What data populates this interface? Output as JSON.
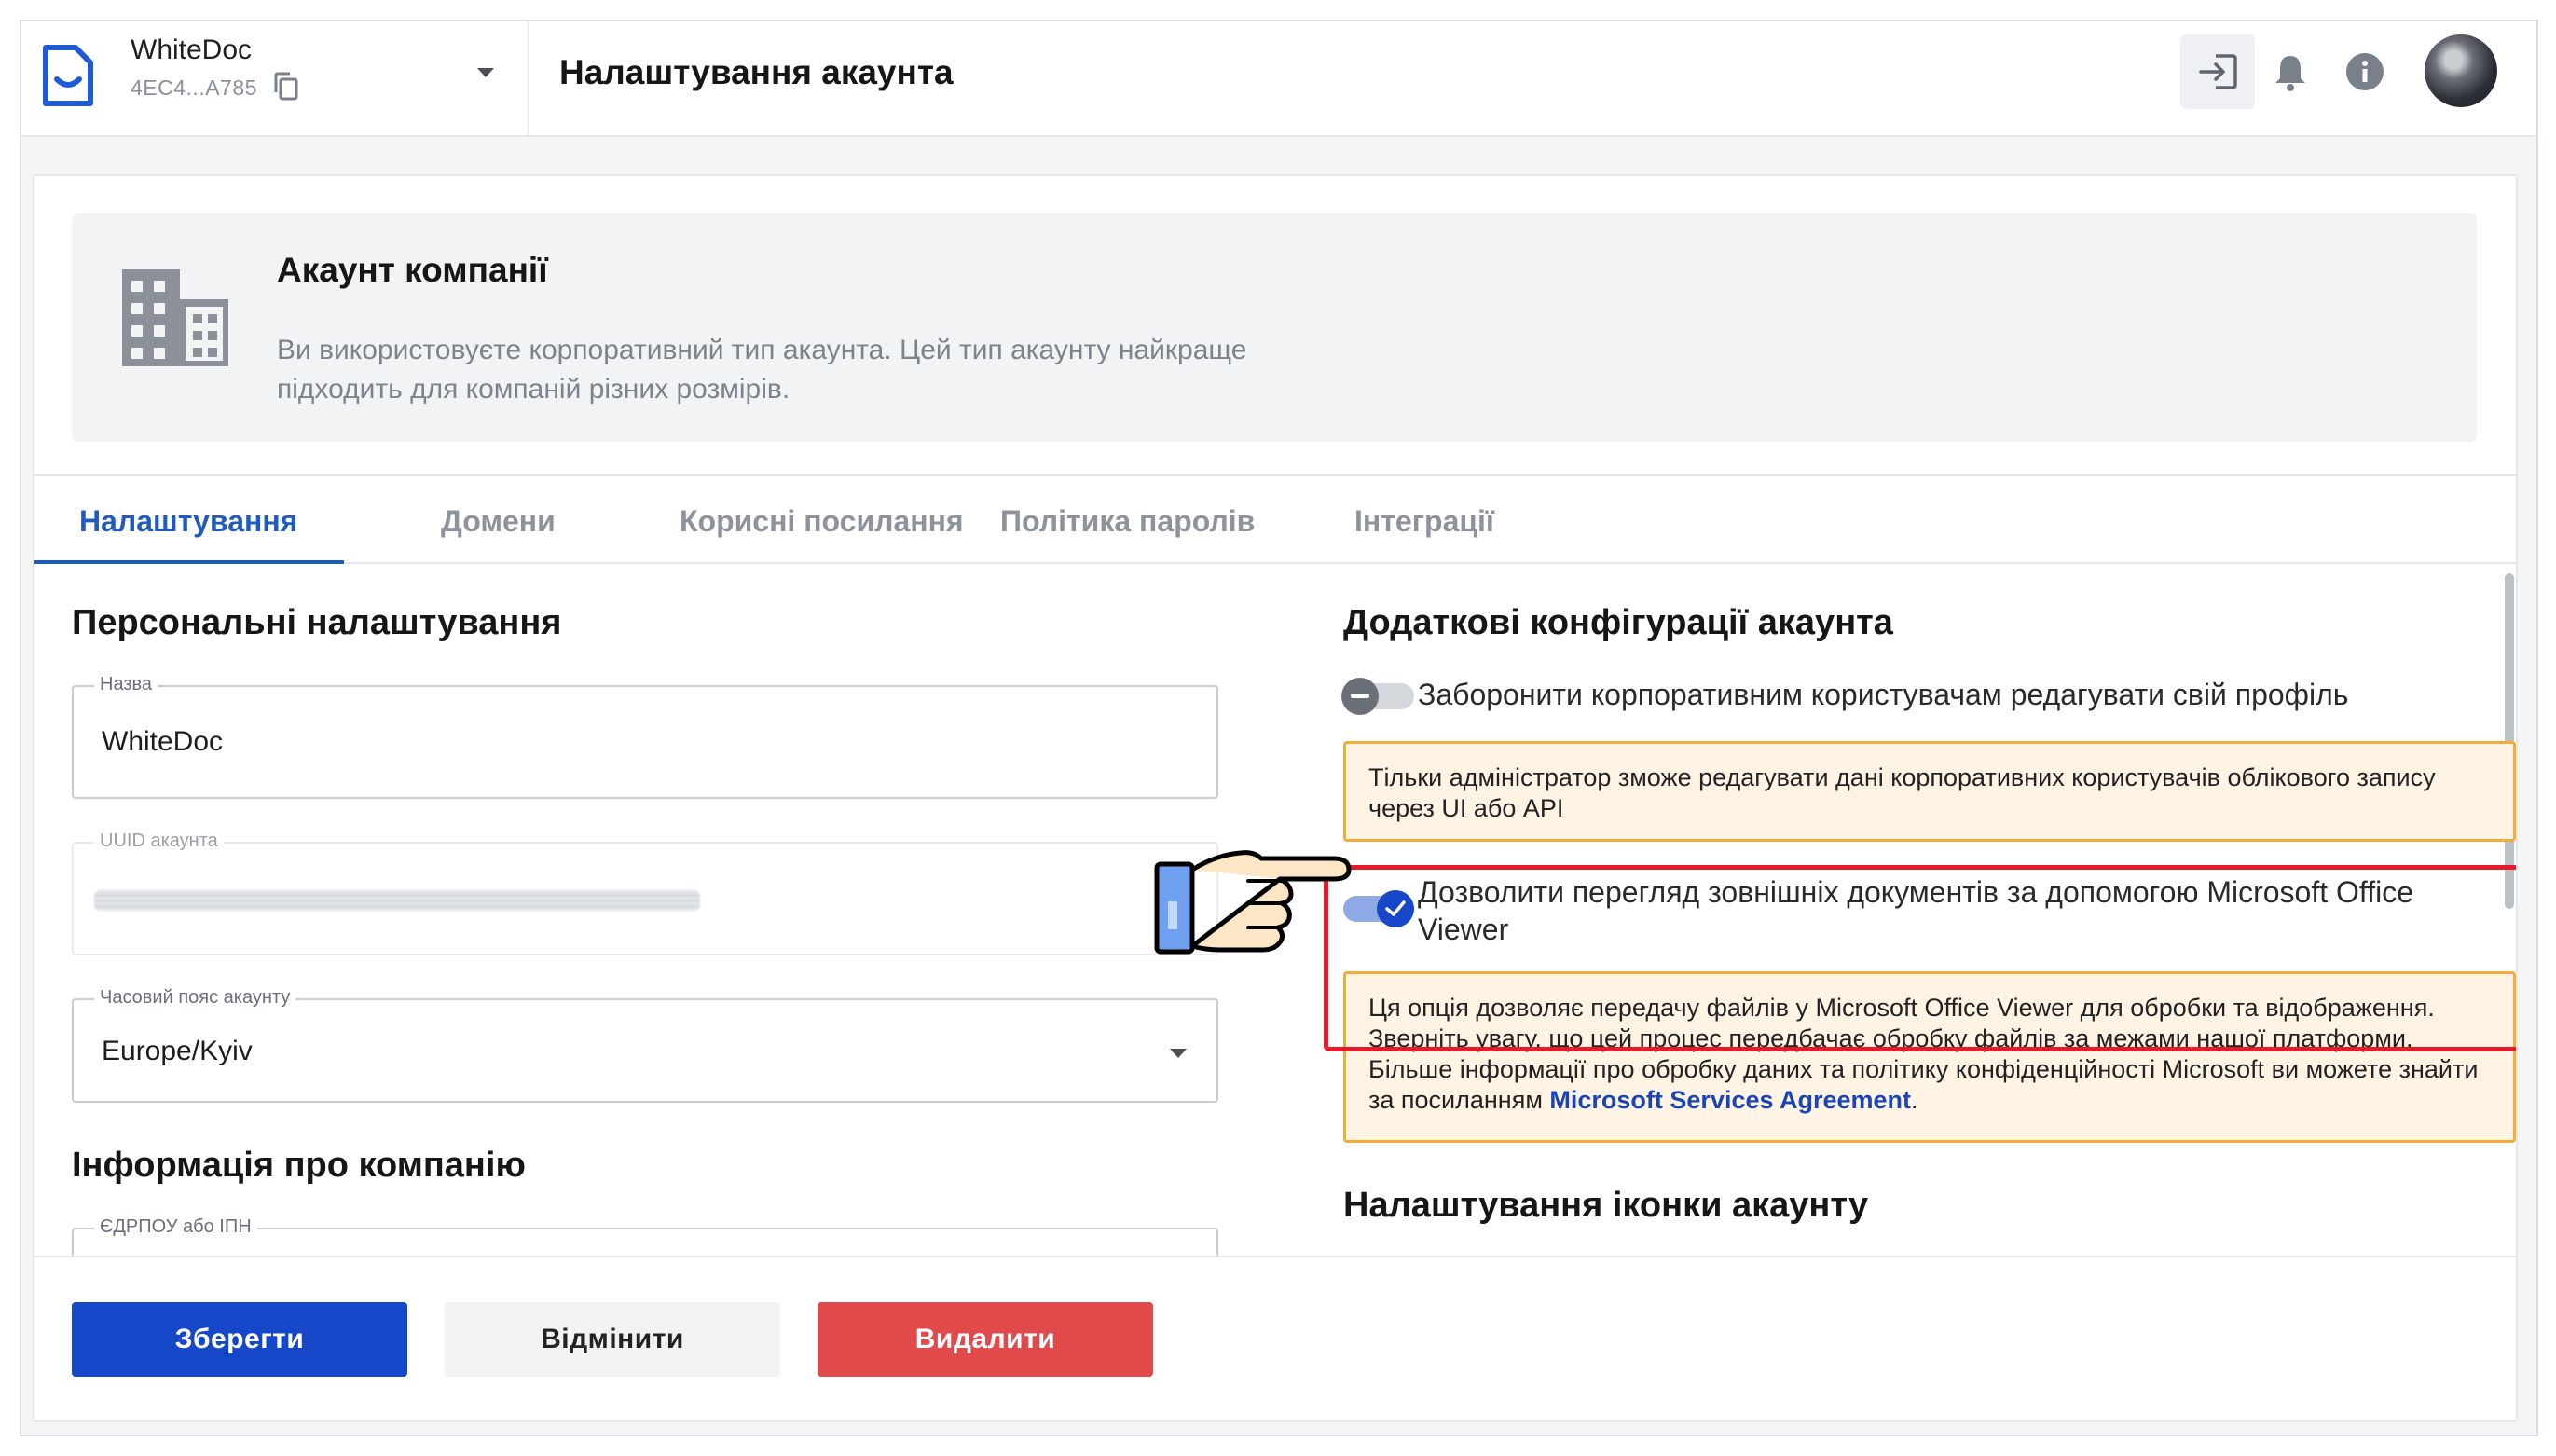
{
  "header": {
    "org_name": "WhiteDoc",
    "org_id": "4EC4...A785",
    "page_title": "Налаштування акаунта"
  },
  "banner": {
    "title": "Акаунт компанії",
    "description": "Ви використовуєте корпоративний тип акаунта. Цей тип акаунту найкраще підходить для компаній різних розмірів."
  },
  "tabs": [
    {
      "label": "Налаштування",
      "active": true
    },
    {
      "label": "Домени",
      "active": false
    },
    {
      "label": "Корисні посилання",
      "active": false
    },
    {
      "label": "Політика паролів",
      "active": false
    },
    {
      "label": "Інтеграції",
      "active": false
    }
  ],
  "personal": {
    "heading": "Персональні налаштування",
    "name_label": "Назва",
    "name_value": "WhiteDoc",
    "uuid_label": "UUID акаунта",
    "timezone_label": "Часовий пояс акаунту",
    "timezone_value": "Europe/Kyiv"
  },
  "company": {
    "heading": "Інформація про компанію",
    "edrpou_label": "ЄДРПОУ або ІПН"
  },
  "extra": {
    "heading": "Додаткові конфігурації акаунта",
    "toggle1_label": "Заборонити корпоративним користувачам редагувати свій профіль",
    "toggle1_on": false,
    "warn1": "Тільки адміністратор зможе редагувати дані корпоративних користувачів облікового запису через UI або API",
    "toggle2_label": "Дозволити перегляд зовнішніх документів за допомогою Microsoft Office Viewer",
    "toggle2_on": true,
    "warn2_text": "Ця опція дозволяє передачу файлів у Microsoft Office Viewer для обробки та відображення. Зверніть увагу, що цей процес передбачає обробку файлів за межами нашої платформи. Більше інформації про обробку даних та політику конфіденційності Microsoft ви можете знайти за посиланням ",
    "warn2_link": "Microsoft Services Agreement",
    "warn2_end": ".",
    "icon_heading": "Налаштування іконки акаунту"
  },
  "actions": {
    "save": "Зберегти",
    "cancel": "Відмінити",
    "delete": "Видалити"
  },
  "colors": {
    "primary": "#1547c8",
    "danger": "#e04a4a",
    "warning_border": "#f0ad3b",
    "highlight": "#e31b2a"
  },
  "icons": [
    "whitedoc-logo-icon",
    "copy-icon",
    "chevron-down-icon",
    "login-icon",
    "bell-icon",
    "info-icon",
    "building-icon",
    "pointing-hand-icon",
    "check-icon",
    "minus-icon"
  ]
}
